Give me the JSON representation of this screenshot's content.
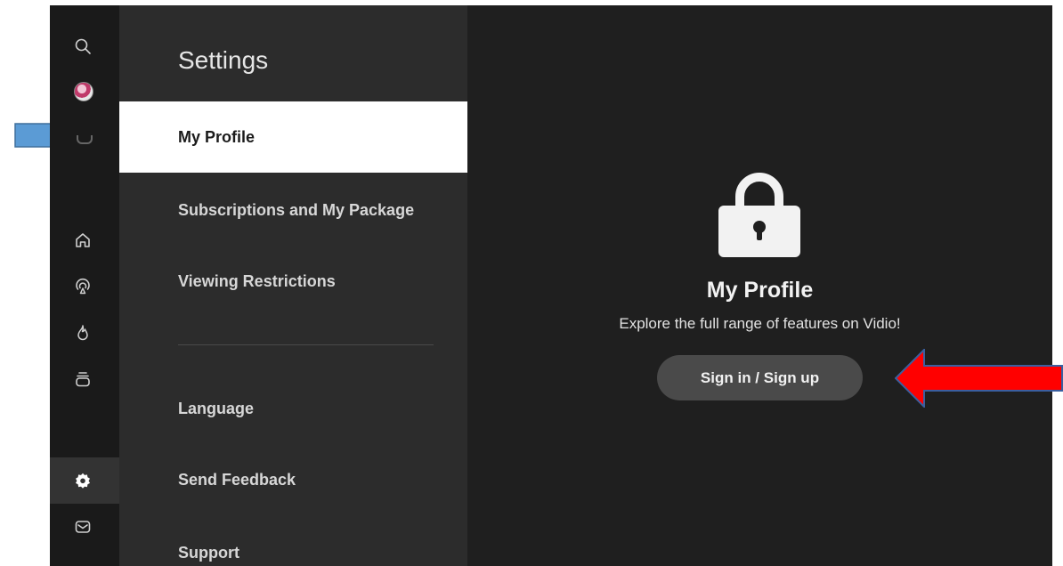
{
  "settings": {
    "title": "Settings",
    "items": [
      {
        "label": "My Profile",
        "active": true
      },
      {
        "label": "Subscriptions and My Package"
      },
      {
        "label": "Viewing Restrictions"
      },
      {
        "label": "Language"
      },
      {
        "label": "Send Feedback"
      },
      {
        "label": "Support"
      }
    ]
  },
  "rail": {
    "icons": [
      "search-icon",
      "avatar",
      "home-icon",
      "live-icon",
      "fire-icon",
      "subscriptions-icon",
      "settings-icon",
      "mail-icon"
    ],
    "active": "settings-icon"
  },
  "content": {
    "icon": "lock-icon",
    "title": "My Profile",
    "description": "Explore the full range of features on Vidio!",
    "button_label": "Sign in / Sign up"
  },
  "annotations": {
    "blue_arrow_color": "#5b9bd5",
    "red_arrow_color": "#ff0000"
  },
  "colors": {
    "rail_bg": "#1a1a1a",
    "menu_bg": "#2c2c2c",
    "content_bg": "#1f1f1f",
    "active_item_bg": "#ffffff",
    "button_bg": "#4a4a4a"
  }
}
